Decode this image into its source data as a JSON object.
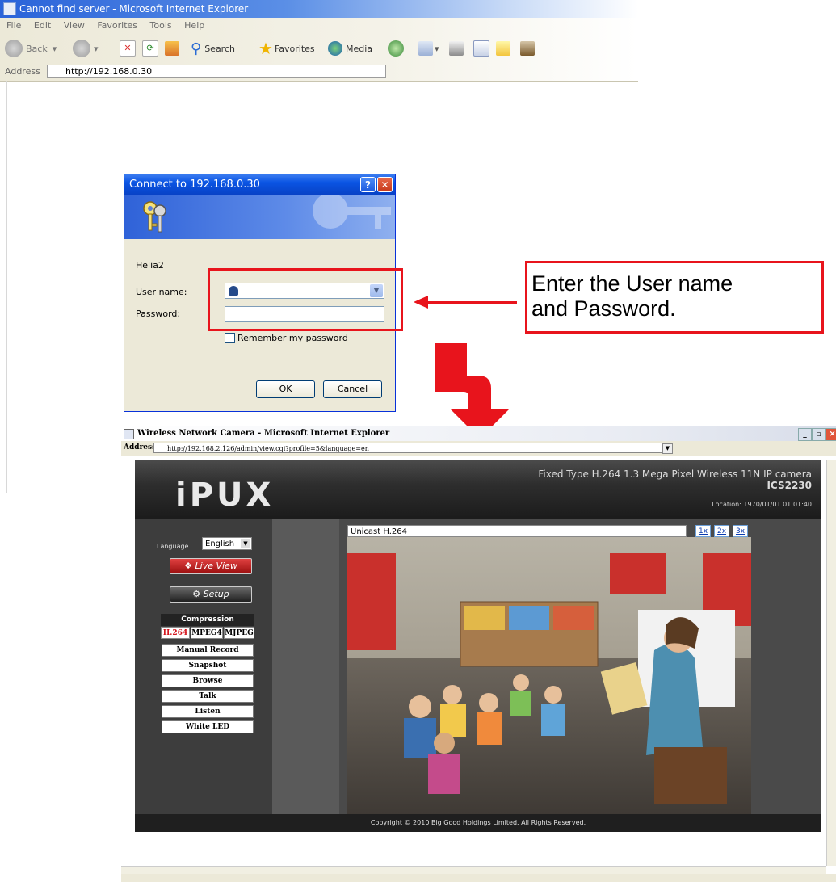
{
  "browser1": {
    "title": "Cannot find server - Microsoft Internet Explorer",
    "menu": [
      "File",
      "Edit",
      "View",
      "Favorites",
      "Tools",
      "Help"
    ],
    "toolbar": {
      "back": "Back",
      "search": "Search",
      "favorites": "Favorites",
      "media": "Media"
    },
    "address_label": "Address",
    "url": "http://192.168.0.30"
  },
  "login_dialog": {
    "title": "Connect to 192.168.0.30",
    "realm": "Helia2",
    "username_label": "User name:",
    "password_label": "Password:",
    "remember_label": "Remember my password",
    "ok": "OK",
    "cancel": "Cancel"
  },
  "callout": {
    "line1": "Enter the User name",
    "line2": "and Password."
  },
  "browser2": {
    "title": "Wireless Network Camera - Microsoft Internet Explorer",
    "address_label": "Address",
    "url": "http://192.168.2.126/admin/view.cgi?profile=5&language=en"
  },
  "camera_page": {
    "logo": "iPUX",
    "model_line1": "Fixed Type H.264 1.3 Mega Pixel Wireless 11N IP camera",
    "model_line2": "ICS2230",
    "location": "Location:   1970/01/01 01:01:40",
    "language_label": "Language",
    "language_value": "English",
    "live_view": "Live View",
    "setup": "Setup",
    "compression_label": "Compression",
    "codecs": [
      "H.264",
      "MPEG4",
      "MJPEG"
    ],
    "menu": [
      "Manual Record",
      "Snapshot",
      "Browse",
      "Talk",
      "Listen",
      "White LED"
    ],
    "stream": "Unicast H.264",
    "zoom": [
      "1x",
      "2x",
      "3x"
    ],
    "footer": "Copyright © 2010 Big Good Holdings Limited. All Rights Reserved."
  }
}
